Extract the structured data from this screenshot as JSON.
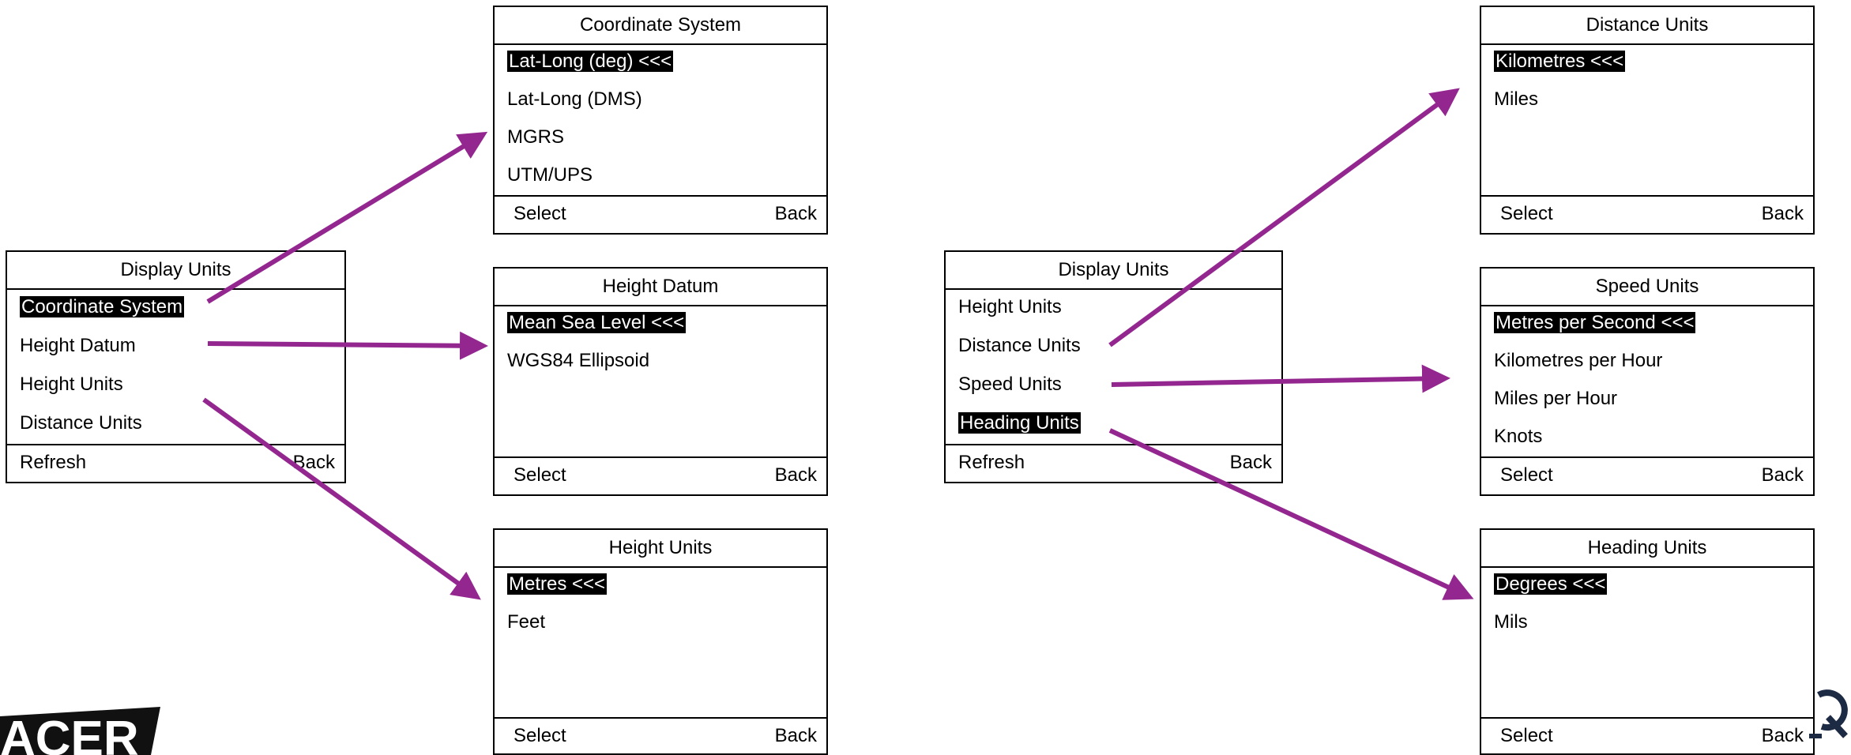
{
  "colors": {
    "arrow": "#93278f",
    "highlight_bg": "#000000",
    "highlight_fg": "#ffffff",
    "border": "#000000"
  },
  "left_menu": {
    "title": "Display Units",
    "items": [
      "Coordinate System",
      "Height Datum",
      "Height Units",
      "Distance Units"
    ],
    "selected_index": 0,
    "footer_left": "Refresh",
    "footer_right": "Back"
  },
  "coordinate_system": {
    "title": "Coordinate System",
    "items": [
      "Lat-Long (deg) <<<",
      "Lat-Long (DMS)",
      "MGRS",
      "UTM/UPS"
    ],
    "selected_index": 0,
    "footer_left": "Select",
    "footer_right": "Back"
  },
  "height_datum": {
    "title": "Height Datum",
    "items": [
      "Mean Sea Level <<<",
      "WGS84 Ellipsoid"
    ],
    "selected_index": 0,
    "footer_left": "Select",
    "footer_right": "Back"
  },
  "height_units": {
    "title": "Height Units",
    "items": [
      "Metres <<<",
      "Feet"
    ],
    "selected_index": 0,
    "footer_left": "Select",
    "footer_right": "Back"
  },
  "right_menu": {
    "title": "Display Units",
    "items": [
      "Height Units",
      "Distance Units",
      "Speed Units",
      "Heading Units"
    ],
    "selected_index": 3,
    "footer_left": "Refresh",
    "footer_right": "Back"
  },
  "distance_units": {
    "title": "Distance Units",
    "items": [
      "Kilometres <<<",
      "Miles"
    ],
    "selected_index": 0,
    "footer_left": "Select",
    "footer_right": "Back"
  },
  "speed_units": {
    "title": "Speed Units",
    "items": [
      "Metres per Second <<<",
      "Kilometres per Hour",
      "Miles per Hour",
      "Knots"
    ],
    "selected_index": 0,
    "footer_left": "Select",
    "footer_right": "Back"
  },
  "heading_units": {
    "title": "Heading Units",
    "items": [
      "Degrees <<<",
      "Mils"
    ],
    "selected_index": 0,
    "footer_left": "Select",
    "footer_right": "Back"
  },
  "logo_left": {
    "text": "ACER",
    "icon": "brand-logo"
  },
  "logo_right": {
    "icon": "q-logo-icon"
  }
}
